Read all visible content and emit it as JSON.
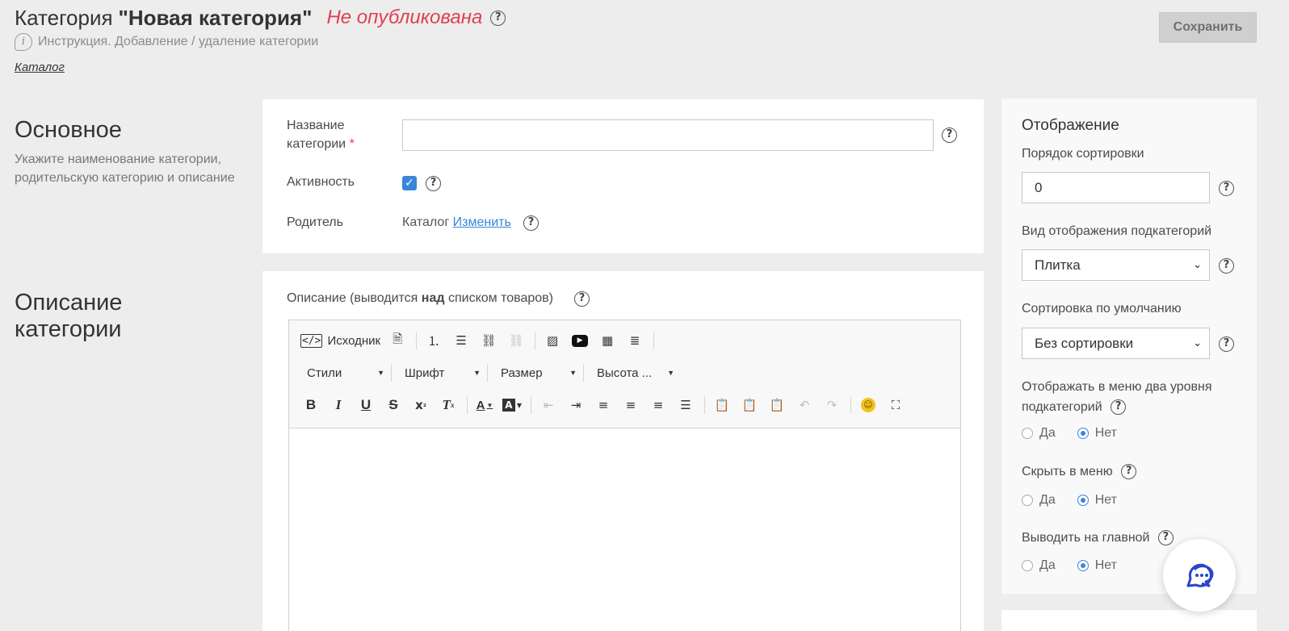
{
  "header": {
    "title_prefix": "Категория",
    "title_name": "\"Новая категория\"",
    "status": "Не опубликована",
    "instruction": "Инструкция. Добавление / удаление категории",
    "breadcrumb": "Каталог",
    "save_label": "Сохранить"
  },
  "basic": {
    "heading": "Основное",
    "description": "Укажите наименование категории, родительскую категорию и описание",
    "name_label_line1": "Название",
    "name_label_line2": "категории",
    "required_mark": "*",
    "name_value": "",
    "activity_label": "Активность",
    "activity_checked": true,
    "parent_label": "Родитель",
    "parent_value": "Каталог",
    "parent_change_link": "Изменить"
  },
  "description": {
    "heading_line1": "Описание",
    "heading_line2": "категории",
    "field_label_before": "Описание (выводится ",
    "field_label_bold": "над",
    "field_label_after": " списком товаров)",
    "editor": {
      "source_label": "Исходник",
      "styles_label": "Стили",
      "font_label": "Шрифт",
      "size_label": "Размер",
      "height_label": "Высота ...",
      "content": ""
    }
  },
  "display": {
    "title": "Отображение",
    "sort_order_label": "Порядок сортировки",
    "sort_order_value": "0",
    "subcat_view_label": "Вид отображения подкатегорий",
    "subcat_view_value": "Плитка",
    "default_sort_label": "Сортировка по умолчанию",
    "default_sort_value": "Без сортировки",
    "two_levels_label_line1": "Отображать в меню два уровня",
    "two_levels_label_line2": "подкатегорий",
    "hide_menu_label": "Скрыть в меню",
    "show_main_label": "Выводить на главной",
    "yes_label": "Да",
    "no_label": "Нет",
    "two_levels_value": "Нет",
    "hide_menu_value": "Нет",
    "show_main_value": "Нет"
  },
  "colors": {
    "accent": "#3a86d9",
    "status_red": "#e03f4f",
    "background": "#ededed"
  },
  "icons": {
    "help": "question-circle-icon",
    "instruction": "info-bubble-icon",
    "chat": "chat-bubble-icon"
  }
}
